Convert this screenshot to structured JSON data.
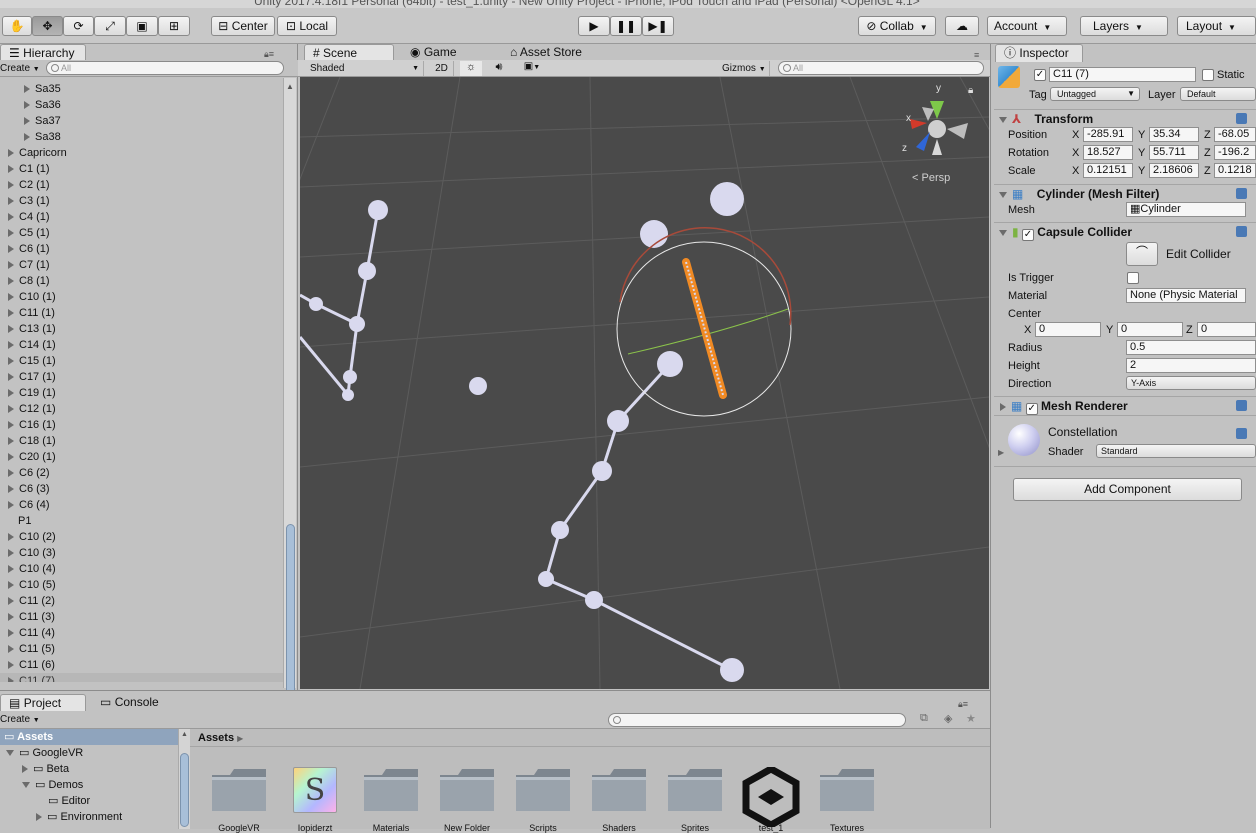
{
  "window": {
    "title": "Unity 2017.4.18f1 Personal (64bit) - test_1.unity - New Unity Project - iPhone, iPod Touch and iPad (Personal) <OpenGL 4.1>"
  },
  "toolbar": {
    "pivot": "Center",
    "space": "Local",
    "collab": "Collab",
    "account": "Account",
    "layers": "Layers",
    "layout": "Layout"
  },
  "hierarchy": {
    "tab": "Hierarchy",
    "create": "Create",
    "search_placeholder": "All",
    "items": [
      "Sa35",
      "Sa36",
      "Sa37",
      "Sa38",
      "Capricorn",
      "C1 (1)",
      "C2 (1)",
      "C3 (1)",
      "C4 (1)",
      "C5 (1)",
      "C6 (1)",
      "C7 (1)",
      "C8 (1)",
      "C10 (1)",
      "C11 (1)",
      "C13 (1)",
      "C14 (1)",
      "C15 (1)",
      "C17 (1)",
      "C19 (1)",
      "C12 (1)",
      "C16 (1)",
      "C18 (1)",
      "C20 (1)",
      "C6 (2)",
      "C6 (3)",
      "C6 (4)",
      "P1",
      "C10 (2)",
      "C10 (3)",
      "C10 (4)",
      "C10 (5)",
      "C11 (2)",
      "C11 (3)",
      "C11 (4)",
      "C11 (5)",
      "C11 (6)",
      "C11 (7)"
    ],
    "selected": "C11 (7)"
  },
  "scene": {
    "tabs": [
      "Scene",
      "Game",
      "Asset Store"
    ],
    "shading": "Shaded",
    "mode_2d": "2D",
    "gizmos": "Gizmos",
    "search_placeholder": "All",
    "persp": "Persp",
    "axis_x": "x",
    "axis_y": "y",
    "axis_z": "z"
  },
  "inspector": {
    "tab": "Inspector",
    "object_name": "C11 (7)",
    "static_label": "Static",
    "tag_label": "Tag",
    "tag_value": "Untagged",
    "layer_label": "Layer",
    "layer_value": "Default",
    "transform": {
      "title": "Transform",
      "position_label": "Position",
      "rotation_label": "Rotation",
      "scale_label": "Scale",
      "position": {
        "x": "-285.91",
        "y": "35.34",
        "z": "-68.05"
      },
      "rotation": {
        "x": "18.527",
        "y": "55.711",
        "z": "-196.2"
      },
      "scale": {
        "x": "0.12151",
        "y": "2.18606",
        "z": "0.1218"
      }
    },
    "mesh_filter": {
      "title": "Cylinder (Mesh Filter)",
      "mesh_label": "Mesh",
      "mesh_value": "Cylinder"
    },
    "capsule_collider": {
      "title": "Capsule Collider",
      "edit_collider": "Edit Collider",
      "is_trigger": "Is Trigger",
      "material_label": "Material",
      "material_value": "None (Physic Material",
      "center_label": "Center",
      "center": {
        "x": "0",
        "y": "0",
        "z": "0"
      },
      "radius_label": "Radius",
      "radius": "0.5",
      "height_label": "Height",
      "height": "2",
      "direction_label": "Direction",
      "direction": "Y-Axis"
    },
    "mesh_renderer": {
      "title": "Mesh Renderer"
    },
    "material": {
      "name": "Constellation",
      "shader_label": "Shader",
      "shader_value": "Standard"
    },
    "add_component": "Add Component"
  },
  "project": {
    "tabs": [
      "Project",
      "Console"
    ],
    "create": "Create",
    "breadcrumb": "Assets",
    "tree": [
      "Assets",
      "GoogleVR",
      "Beta",
      "Demos",
      "Editor",
      "Environment"
    ],
    "assets": [
      "GoogleVR",
      "Iopiderzt",
      "Materials",
      "New Folder",
      "Scripts",
      "Shaders",
      "Sprites",
      "test_1",
      "Textures"
    ]
  },
  "colors": {
    "scene_bg": "#4a4a4a",
    "accent": "#f08a24",
    "selection": "#b7b7b7",
    "star": "#d9d9ee"
  }
}
